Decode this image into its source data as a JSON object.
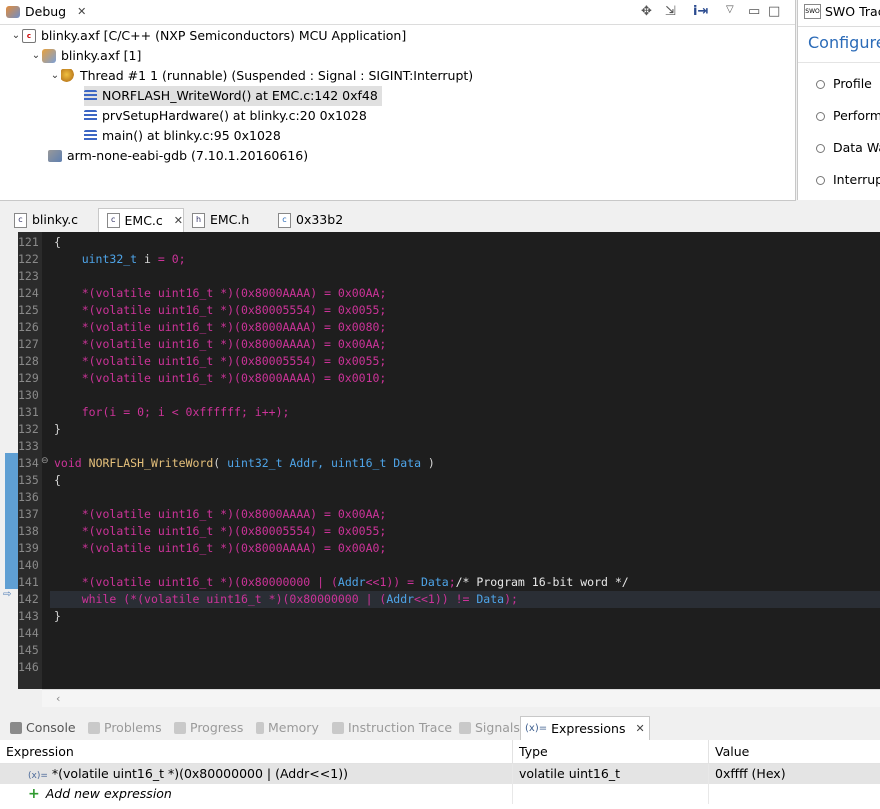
{
  "debug_view": {
    "title": "Debug",
    "tree": {
      "launch": "blinky.axf [C/C++ (NXP Semiconductors) MCU Application]",
      "process": "blinky.axf [1]",
      "thread": "Thread #1 1 (runnable) (Suspended : Signal : SIGINT:Interrupt)",
      "frames": [
        "NORFLASH_WriteWord() at EMC.c:142 0xf48",
        "prvSetupHardware() at blinky.c:20 0x1028",
        "main() at blinky.c:95 0x1028"
      ],
      "gdb": "arm-none-eabi-gdb (7.10.1.20160616)"
    }
  },
  "swo_view": {
    "title": "SWO Trac",
    "heading": "Configure",
    "items": [
      "Profile",
      "Perform",
      "Data Wa",
      "Interrupt"
    ]
  },
  "editor": {
    "tabs": [
      {
        "label": "blinky.c",
        "icon": "c-file-icon"
      },
      {
        "label": "EMC.c",
        "icon": "c-file-icon",
        "active": true
      },
      {
        "label": "EMC.h",
        "icon": "h-file-icon"
      },
      {
        "label": "0x33b2",
        "icon": "disassembly-icon"
      }
    ],
    "line_numbers": [
      "121",
      "122",
      "123",
      "124",
      "125",
      "126",
      "127",
      "128",
      "129",
      "130",
      "131",
      "132",
      "133",
      "134",
      "135",
      "136",
      "137",
      "138",
      "139",
      "140",
      "141",
      "142",
      "143",
      "144",
      "145",
      "146"
    ],
    "current_line": "142",
    "lines": [
      [
        {
          "t": "{",
          "c": "#d4d4d4"
        }
      ],
      [
        {
          "t": "    ",
          "c": "#d4d4d4"
        },
        {
          "t": "uint32_t",
          "c": "#4ea4e8"
        },
        {
          "t": " i ",
          "c": "#d4d4d4"
        },
        {
          "t": "=",
          "c": "#cc3399"
        },
        {
          "t": " 0;",
          "c": "#cc3399"
        }
      ],
      [],
      [
        {
          "t": "    ",
          "c": "#d4d4d4"
        },
        {
          "t": "*(",
          "c": "#cc3399"
        },
        {
          "t": "volatile uint16_t",
          "c": "#cc3399"
        },
        {
          "t": " *)(",
          "c": "#cc3399"
        },
        {
          "t": "0x8000AAAA",
          "c": "#cc3399"
        },
        {
          "t": ") = ",
          "c": "#cc3399"
        },
        {
          "t": "0x00AA;",
          "c": "#cc3399"
        }
      ],
      [
        {
          "t": "    ",
          "c": "#d4d4d4"
        },
        {
          "t": "*(volatile uint16_t *)(0x80005554) = 0x0055;",
          "c": "#cc3399"
        }
      ],
      [
        {
          "t": "    ",
          "c": "#d4d4d4"
        },
        {
          "t": "*(volatile uint16_t *)(0x8000AAAA) = 0x0080;",
          "c": "#cc3399"
        }
      ],
      [
        {
          "t": "    ",
          "c": "#d4d4d4"
        },
        {
          "t": "*(volatile uint16_t *)(0x8000AAAA) = 0x00AA;",
          "c": "#cc3399"
        }
      ],
      [
        {
          "t": "    ",
          "c": "#d4d4d4"
        },
        {
          "t": "*(volatile uint16_t *)(0x80005554) = 0x0055;",
          "c": "#cc3399"
        }
      ],
      [
        {
          "t": "    ",
          "c": "#d4d4d4"
        },
        {
          "t": "*(volatile uint16_t *)(0x8000AAAA) = 0x0010;",
          "c": "#cc3399"
        }
      ],
      [],
      [
        {
          "t": "    ",
          "c": "#d4d4d4"
        },
        {
          "t": "for(i = 0; i < 0xffffff; i++);",
          "c": "#cc3399"
        }
      ],
      [
        {
          "t": "}",
          "c": "#d4d4d4"
        }
      ],
      [],
      [
        {
          "t": "void",
          "c": "#cc3399"
        },
        {
          "t": " ",
          "c": "#d4d4d4"
        },
        {
          "t": "NORFLASH_WriteWord",
          "c": "#e5c07b"
        },
        {
          "t": "( ",
          "c": "#d4d4d4"
        },
        {
          "t": "uint32_t",
          "c": "#4ea4e8"
        },
        {
          "t": " Addr, ",
          "c": "#4ea4e8"
        },
        {
          "t": "uint16_t",
          "c": "#4ea4e8"
        },
        {
          "t": " Data ",
          "c": "#4ea4e8"
        },
        {
          "t": ")",
          "c": "#d4d4d4"
        }
      ],
      [
        {
          "t": "{",
          "c": "#d4d4d4"
        }
      ],
      [],
      [
        {
          "t": "    ",
          "c": "#d4d4d4"
        },
        {
          "t": "*(volatile uint16_t *)(0x8000AAAA) = 0x00AA;",
          "c": "#cc3399"
        }
      ],
      [
        {
          "t": "    ",
          "c": "#d4d4d4"
        },
        {
          "t": "*(volatile uint16_t *)(0x80005554) = 0x0055;",
          "c": "#cc3399"
        }
      ],
      [
        {
          "t": "    ",
          "c": "#d4d4d4"
        },
        {
          "t": "*(volatile uint16_t *)(0x8000AAAA) = 0x00A0;",
          "c": "#cc3399"
        }
      ],
      [],
      [
        {
          "t": "    ",
          "c": "#d4d4d4"
        },
        {
          "t": "*(volatile uint16_t *)(0x80000000 | (",
          "c": "#cc3399"
        },
        {
          "t": "Addr",
          "c": "#4ea4e8"
        },
        {
          "t": "<<1)) = ",
          "c": "#cc3399"
        },
        {
          "t": "Data",
          "c": "#4ea4e8"
        },
        {
          "t": ";",
          "c": "#cc3399"
        },
        {
          "t": "/* Program 16-bit word */",
          "c": "#e8e8e8"
        }
      ],
      [
        {
          "t": "    ",
          "c": "#d4d4d4"
        },
        {
          "t": "while (*(volatile uint16_t *)(0x80000000 | (",
          "c": "#cc3399"
        },
        {
          "t": "Addr",
          "c": "#4ea4e8"
        },
        {
          "t": "<<1)) != ",
          "c": "#cc3399"
        },
        {
          "t": "Data",
          "c": "#4ea4e8"
        },
        {
          "t": ");",
          "c": "#cc3399"
        }
      ],
      [
        {
          "t": "}",
          "c": "#d4d4d4"
        }
      ],
      [],
      [],
      []
    ]
  },
  "bottom_panel": {
    "tabs": [
      "Console",
      "Problems",
      "Progress",
      "Memory",
      "Instruction Trace",
      "Signals",
      "Expressions"
    ],
    "active_tab": "Expressions",
    "expressions": {
      "columns": [
        "Expression",
        "Type",
        "Value"
      ],
      "rows": [
        {
          "expression": "*(volatile uint16_t *)(0x80000000 | (Addr<<1))",
          "type": "volatile uint16_t",
          "value": "0xffff (Hex)"
        }
      ],
      "add_label": "Add new expression"
    }
  },
  "colors": {
    "editor_bg": "#1e1e1e",
    "keyword": "#cc3399",
    "type": "#4ea4e8",
    "function": "#e5c07b",
    "selection_ruler": "#5f9fd3"
  }
}
